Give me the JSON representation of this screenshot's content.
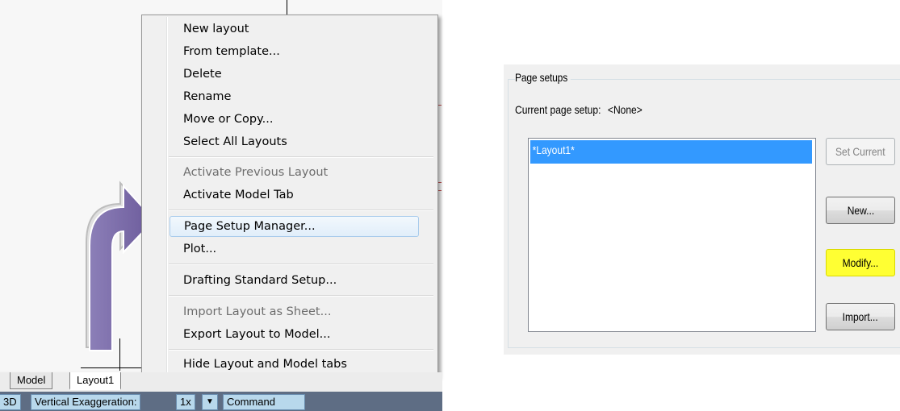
{
  "context_menu": {
    "items": [
      {
        "label": "New layout",
        "enabled": true
      },
      {
        "label": "From template...",
        "enabled": true
      },
      {
        "label": "Delete",
        "enabled": true
      },
      {
        "label": "Rename",
        "enabled": true
      },
      {
        "label": "Move or Copy...",
        "enabled": true
      },
      {
        "label": "Select All Layouts",
        "enabled": true
      },
      {
        "label": "Activate Previous Layout",
        "enabled": false
      },
      {
        "label": "Activate Model Tab",
        "enabled": true
      },
      {
        "label": "Page Setup Manager...",
        "enabled": true,
        "highlighted": true
      },
      {
        "label": "Plot...",
        "enabled": true
      },
      {
        "label": "Drafting Standard Setup...",
        "enabled": true
      },
      {
        "label": "Import Layout as Sheet...",
        "enabled": false
      },
      {
        "label": "Export Layout to Model...",
        "enabled": true
      },
      {
        "label": "Hide Layout and Model tabs",
        "enabled": true
      }
    ]
  },
  "layout_tabs": {
    "model": "Model",
    "layout1": "Layout1"
  },
  "status_bar": {
    "mode": "3D",
    "exaggeration_label": "Vertical Exaggeration:",
    "exaggeration_value": "1x",
    "dropdown_glyph": "▼",
    "command": "Command"
  },
  "page_setups": {
    "group_title": "Page setups",
    "current_setup_label": "Current page setup:",
    "current_setup_value": "<None>",
    "list_items": [
      "*Layout1*"
    ],
    "selected_index": 0,
    "buttons": {
      "set_current": "Set Current",
      "new": "New...",
      "modify": "Modify...",
      "import": "Import..."
    }
  },
  "colors": {
    "arrow": "#7b6aa8",
    "highlight_button": "#ffff33",
    "selection": "#3399ff",
    "status_bar": "#5e6d84"
  }
}
